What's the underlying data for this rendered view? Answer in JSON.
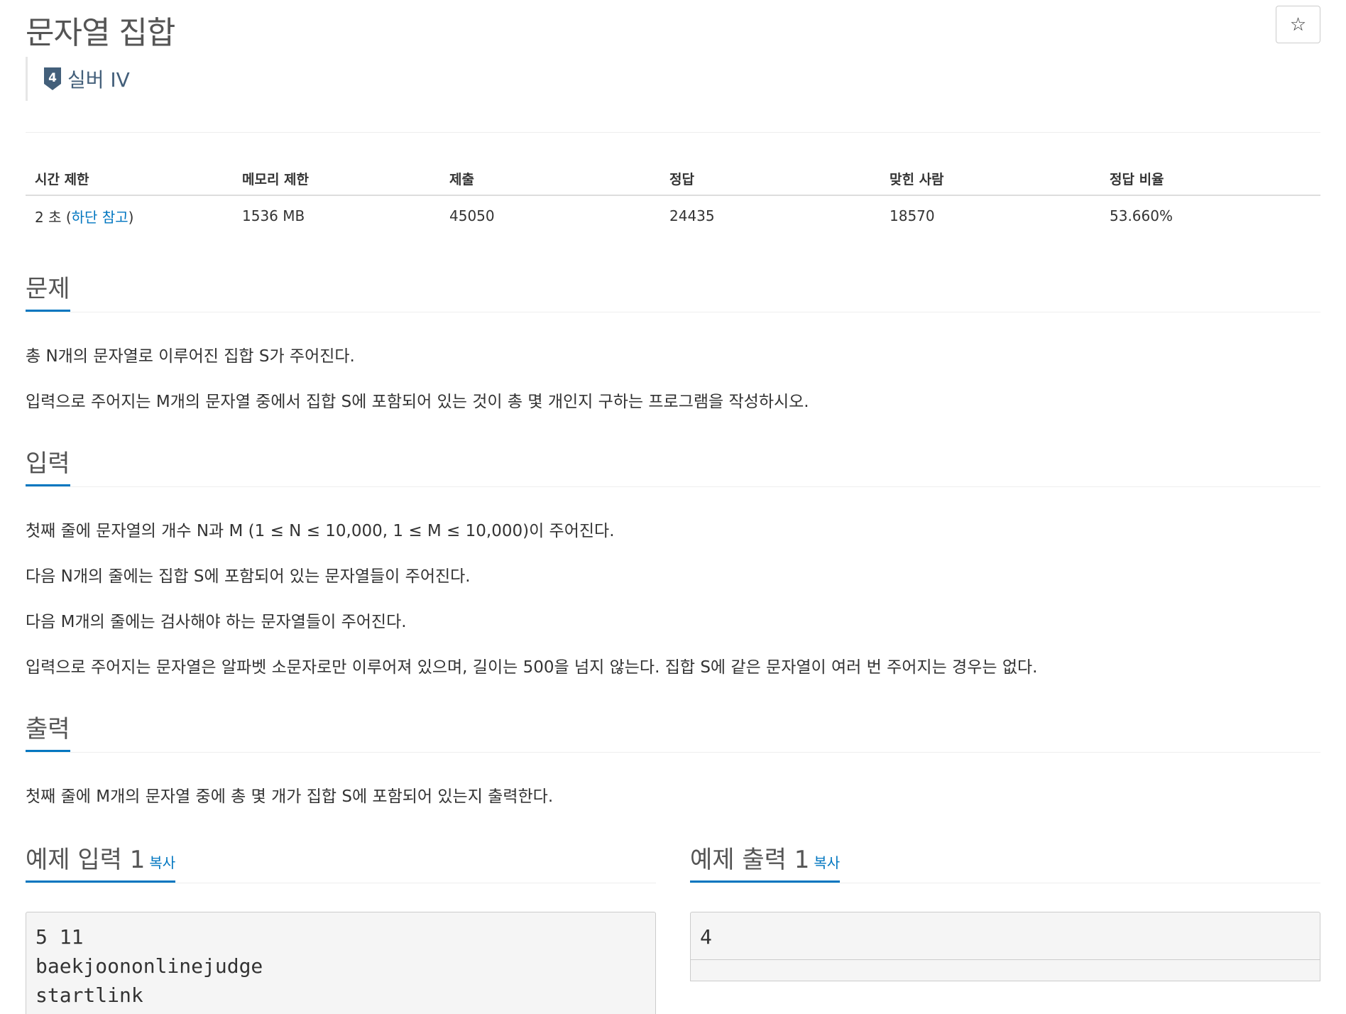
{
  "title": "문자열 집합",
  "star": "☆",
  "tier": {
    "level": "4",
    "label": "실버 IV"
  },
  "info": {
    "headers": [
      "시간 제한",
      "메모리 제한",
      "제출",
      "정답",
      "맞힌 사람",
      "정답 비율"
    ],
    "time_prefix": "2 초 (",
    "time_link": "하단 참고",
    "time_suffix": ")",
    "memory": "1536 MB",
    "submissions": "45050",
    "accepted": "24435",
    "solvers": "18570",
    "ratio": "53.660%"
  },
  "problem": {
    "title": "문제",
    "lines": [
      "총 N개의 문자열로 이루어진 집합 S가 주어진다.",
      "입력으로 주어지는 M개의 문자열 중에서 집합 S에 포함되어 있는 것이 총 몇 개인지 구하는 프로그램을 작성하시오."
    ]
  },
  "input": {
    "title": "입력",
    "lines": [
      "첫째 줄에 문자열의 개수 N과 M (1 ≤ N ≤ 10,000, 1 ≤ M ≤ 10,000)이 주어진다.",
      "다음 N개의 줄에는 집합 S에 포함되어 있는 문자열들이 주어진다.",
      "다음 M개의 줄에는 검사해야 하는 문자열들이 주어진다.",
      "입력으로 주어지는 문자열은 알파벳 소문자로만 이루어져 있으며, 길이는 500을 넘지 않는다. 집합 S에 같은 문자열이 여러 번 주어지는 경우는 없다."
    ]
  },
  "output": {
    "title": "출력",
    "lines": [
      "첫째 줄에 M개의 문자열 중에 총 몇 개가 집합 S에 포함되어 있는지 출력한다."
    ]
  },
  "sample_input": {
    "title": "예제 입력 1",
    "copy": "복사",
    "content": "5 11\nbaekjoononlinejudge\nstartlink"
  },
  "sample_output": {
    "title": "예제 출력 1",
    "copy": "복사",
    "content": "4"
  }
}
